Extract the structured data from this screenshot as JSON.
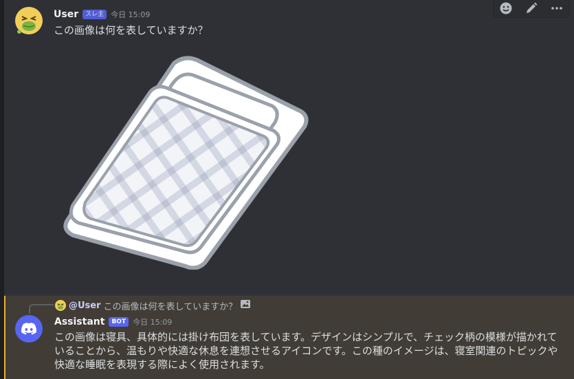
{
  "user_message": {
    "username": "User",
    "tag": "スレ主",
    "timestamp": "今日 15:09",
    "text": "この画像は何を表していますか？",
    "image_alt": "futon-illustration",
    "toolbar": {
      "icons": [
        "emoji-icon",
        "pencil-icon",
        "more-icon"
      ]
    }
  },
  "bot_message": {
    "reply": {
      "mention": "@User",
      "text": "この画像は何を表していますか？",
      "icon": "image-icon"
    },
    "username": "Assistant",
    "badge": "BOT",
    "timestamp": "今日 15:09",
    "text": "この画像は寝具、具体的には掛け布団を表しています。デザインはシンプルで、チェック柄の模様が描かれていることから、温もりや快適な休息を連想させるアイコンです。この種のイメージは、寝室関連のトピックや快適な睡眠を表現する際によく使用されます。"
  },
  "colors": {
    "background": "#313338",
    "highlight": "#413d36",
    "accent": "#5865f2",
    "highlight_bar": "#f0b232"
  }
}
